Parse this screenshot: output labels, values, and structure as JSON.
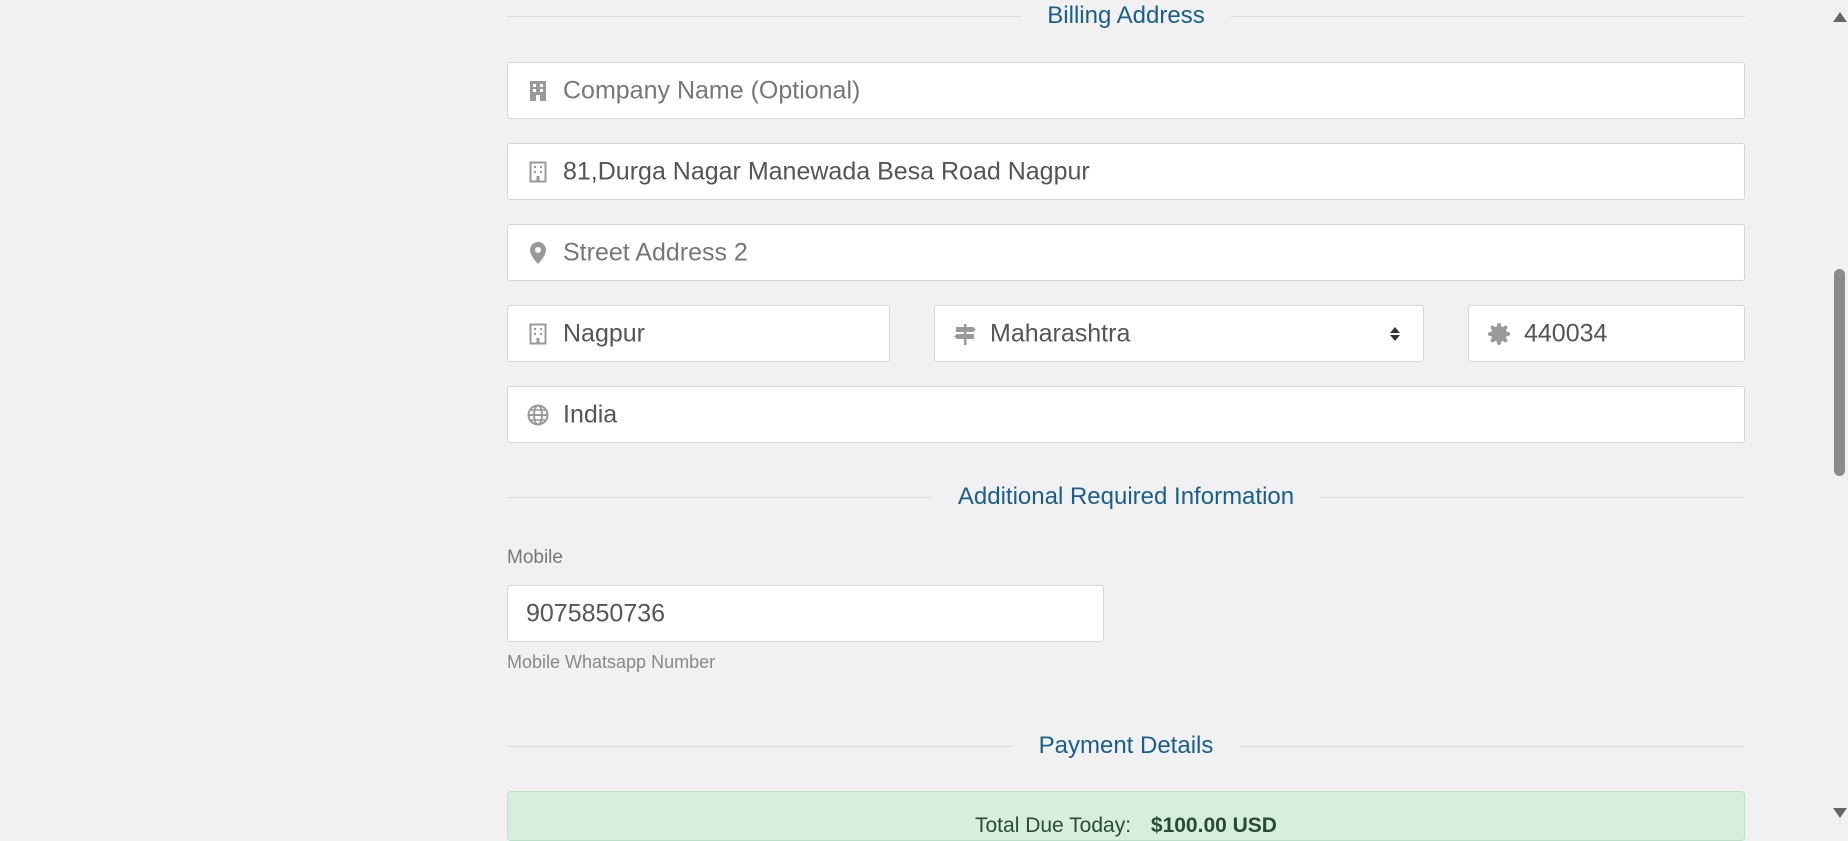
{
  "sections": {
    "billing_address": "Billing Address",
    "additional_info": "Additional Required Information",
    "payment_details": "Payment Details"
  },
  "billing": {
    "company_name": {
      "placeholder": "Company Name (Optional)",
      "value": "",
      "icon": "building-icon"
    },
    "address1": {
      "value": "81,Durga Nagar Manewada Besa Road Nagpur",
      "icon": "building-icon"
    },
    "address2": {
      "placeholder": "Street Address 2",
      "value": "",
      "icon": "map-marker-icon"
    },
    "city": {
      "value": "Nagpur",
      "icon": "building-icon"
    },
    "state": {
      "value": "Maharashtra",
      "icon": "signpost-icon"
    },
    "postcode": {
      "value": "440034",
      "icon": "certificate-icon"
    },
    "country": {
      "value": "India",
      "icon": "globe-icon"
    }
  },
  "additional": {
    "mobile_label": "Mobile",
    "mobile_value": "9075850736",
    "mobile_help": "Mobile Whatsapp Number"
  },
  "payment": {
    "total_due_label": "Total Due Today:",
    "total_due_amount": "$100.00 USD"
  },
  "colors": {
    "heading": "#1a5e8c",
    "background": "#f1f1f1",
    "due_box": "#d6eedd"
  }
}
